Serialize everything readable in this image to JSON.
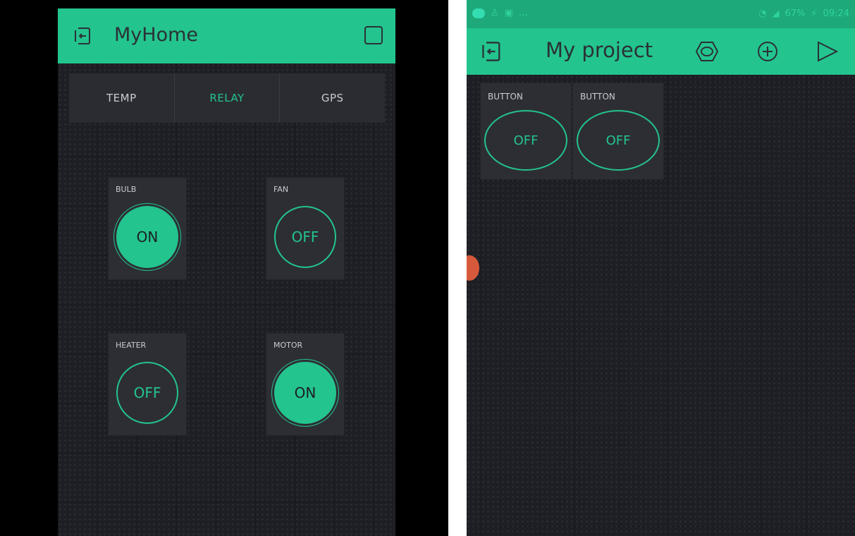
{
  "left_app": {
    "title": "MyHome",
    "tabs": [
      {
        "label": "TEMP",
        "active": false
      },
      {
        "label": "RELAY",
        "active": true
      },
      {
        "label": "GPS",
        "active": false
      }
    ],
    "widgets": [
      {
        "label": "BULB",
        "state": "ON"
      },
      {
        "label": "FAN",
        "state": "OFF"
      },
      {
        "label": "HEATER",
        "state": "OFF"
      },
      {
        "label": "MOTOR",
        "state": "ON"
      }
    ]
  },
  "right_app": {
    "status_bar": {
      "battery": "67%",
      "time": "09:24"
    },
    "title": "My project",
    "widgets": [
      {
        "label": "BUTTON",
        "state": "OFF"
      },
      {
        "label": "BUTTON",
        "state": "OFF"
      }
    ]
  },
  "colors": {
    "accent": "#23c48e",
    "background": "#1e1f25",
    "widget": "#2d2e34",
    "text_dark": "#2b3136",
    "status_bar": "#1ea97b"
  },
  "icons": {
    "exit": "exit-icon",
    "square": "square-icon",
    "settings": "hexagon-settings-icon",
    "add": "plus-circle-icon",
    "play": "play-icon"
  }
}
